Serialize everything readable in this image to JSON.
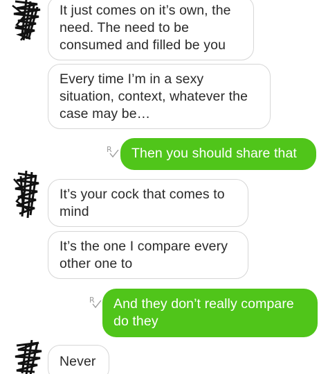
{
  "conversation": {
    "messages": [
      {
        "sender": "contact",
        "text": "It just comes on it’s own, the\nneed. The need to be\nconsumed and filled be you"
      },
      {
        "sender": "contact",
        "text": "Every time I’m in a sexy\nsituation, context, whatever the\ncase may be…"
      },
      {
        "sender": "me",
        "text": "Then you should share that",
        "status": "read"
      },
      {
        "sender": "contact",
        "text": "It’s your cock that comes to\nmind"
      },
      {
        "sender": "contact",
        "text": "It’s the one I compare every\nother one to"
      },
      {
        "sender": "me",
        "text": "And they don’t really compare\ndo they",
        "status": "read"
      },
      {
        "sender": "contact",
        "text": "Never"
      }
    ]
  },
  "colors": {
    "outgoing_bubble": "#50c51a",
    "incoming_border": "#d6d6d6",
    "read_receipt": "#9a9a9a",
    "avatar_scribble": "#111111"
  },
  "icons": {
    "avatar": "redacted-avatar-icon",
    "read_receipt": "read-receipt-icon"
  }
}
